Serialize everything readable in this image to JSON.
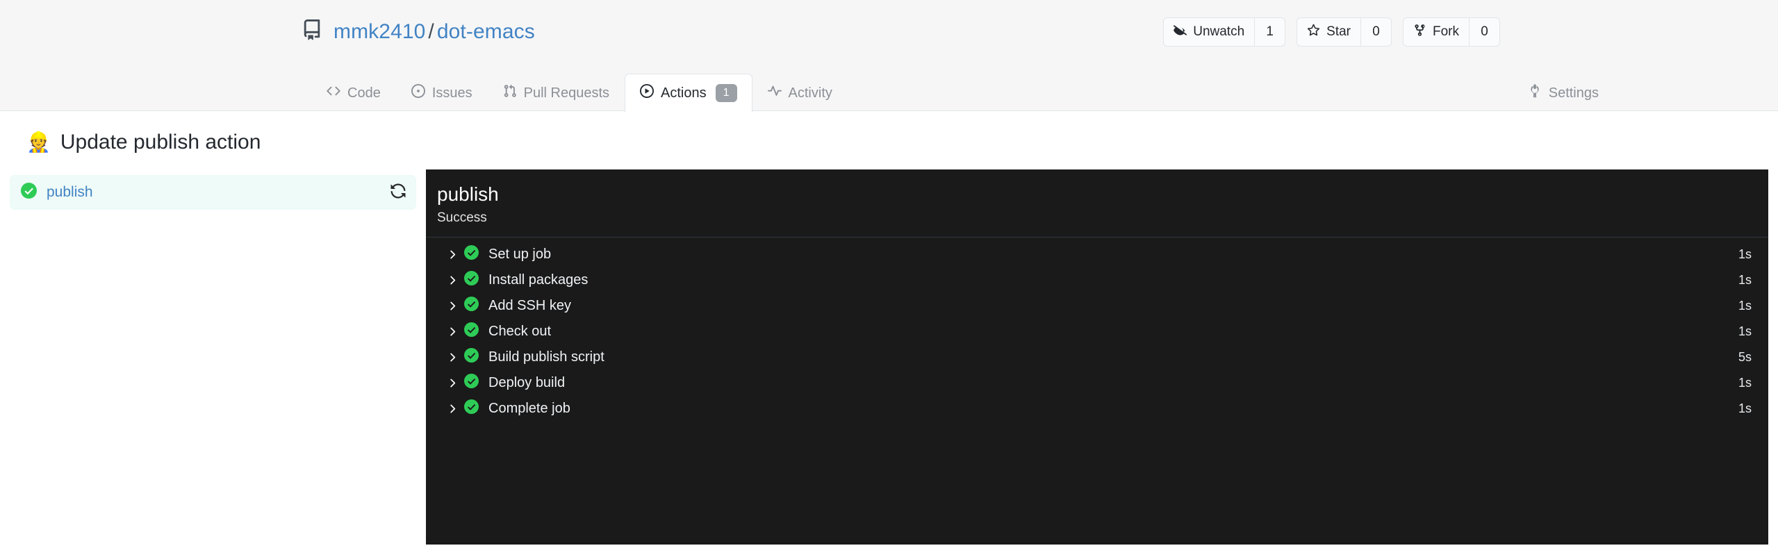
{
  "header": {
    "repo_icon": "book-icon",
    "owner": "mmk2410",
    "separator": "/",
    "repo": "dot-emacs",
    "actions": [
      {
        "icon": "eye-closed-icon",
        "label": "Unwatch",
        "count": "1"
      },
      {
        "icon": "star-icon",
        "label": "Star",
        "count": "0"
      },
      {
        "icon": "fork-icon",
        "label": "Fork",
        "count": "0"
      }
    ],
    "tabs": [
      {
        "icon": "code-icon",
        "label": "Code",
        "active": false,
        "badge": null
      },
      {
        "icon": "issue-opened-icon",
        "label": "Issues",
        "active": false,
        "badge": null
      },
      {
        "icon": "git-pull-request-icon",
        "label": "Pull Requests",
        "active": false,
        "badge": null
      },
      {
        "icon": "play-icon",
        "label": "Actions",
        "active": true,
        "badge": "1"
      },
      {
        "icon": "pulse-icon",
        "label": "Activity",
        "active": false,
        "badge": null
      }
    ],
    "settings_tab": {
      "icon": "wrench-icon",
      "label": "Settings"
    }
  },
  "run": {
    "emoji": "👷",
    "title": "Update publish action"
  },
  "sidebar": {
    "jobs": [
      {
        "status_icon": "check-circle-icon",
        "name": "publish",
        "rerun_icon": "sync-icon"
      }
    ]
  },
  "log": {
    "job_title": "publish",
    "job_status": "Success",
    "steps": [
      {
        "chevron": "chevron-right-icon",
        "status_icon": "check-circle-icon",
        "name": "Set up job",
        "duration": "1s"
      },
      {
        "chevron": "chevron-right-icon",
        "status_icon": "check-circle-icon",
        "name": "Install packages",
        "duration": "1s"
      },
      {
        "chevron": "chevron-right-icon",
        "status_icon": "check-circle-icon",
        "name": "Add SSH key",
        "duration": "1s"
      },
      {
        "chevron": "chevron-right-icon",
        "status_icon": "check-circle-icon",
        "name": "Check out",
        "duration": "1s"
      },
      {
        "chevron": "chevron-right-icon",
        "status_icon": "check-circle-icon",
        "name": "Build publish script",
        "duration": "5s"
      },
      {
        "chevron": "chevron-right-icon",
        "status_icon": "check-circle-icon",
        "name": "Deploy build",
        "duration": "1s"
      },
      {
        "chevron": "chevron-right-icon",
        "status_icon": "check-circle-icon",
        "name": "Complete job",
        "duration": "1s"
      }
    ]
  },
  "colors": {
    "success_green": "#2ecc57",
    "link_blue": "#4183c4",
    "panel_dark": "#1a1a1a",
    "header_bg": "#f6f6f7",
    "job_row_bg": "#eefbf8",
    "badge_gray": "#9aa0a6"
  }
}
